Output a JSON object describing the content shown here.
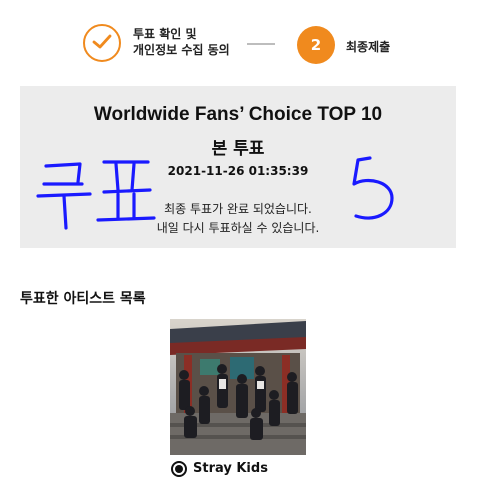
{
  "stepper": {
    "step1": {
      "state": "done",
      "icon": "check-icon",
      "label_line1": "투표 확인 및",
      "label_line2": "개인정보 수집 동의"
    },
    "step2": {
      "number": "2",
      "label": "최종제출"
    },
    "accent_color": "#F08A1E"
  },
  "result": {
    "event_title": "Worldwide Fans’ Choice TOP 10",
    "vote_type": "본 투표",
    "timestamp": "2021-11-26 01:35:39",
    "message_line1": "최종 투표가 완료 되었습니다.",
    "message_line2": "내일 다시 투표하실 수 있습니다.",
    "handwriting": "투표 5",
    "handwriting_color": "#1a1aff"
  },
  "artists_section": {
    "title": "투표한 아티스트 목록",
    "artists": [
      {
        "name": "Stray Kids",
        "selected": true
      }
    ]
  }
}
